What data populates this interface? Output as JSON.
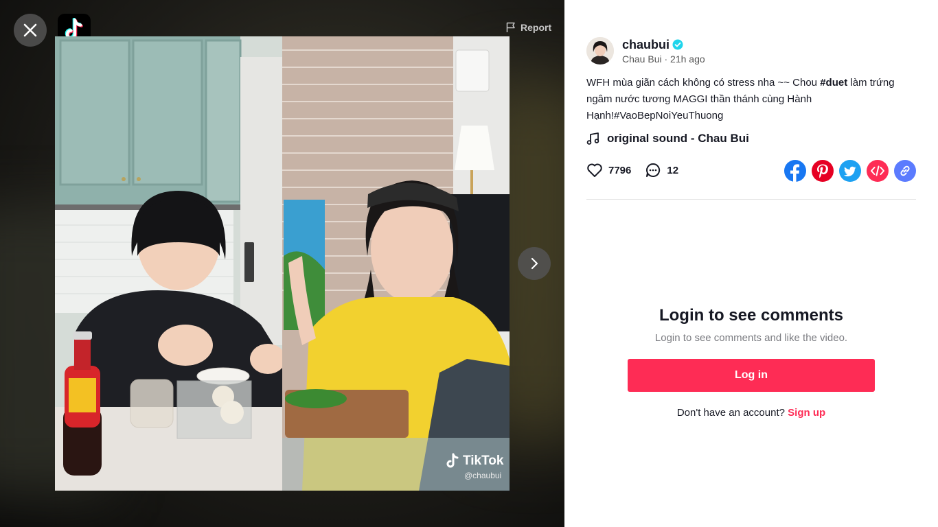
{
  "header": {
    "report_label": "Report"
  },
  "video": {
    "watermark_brand": "TikTok",
    "watermark_handle": "@chaubui"
  },
  "author": {
    "username": "chaubui",
    "display_name": "Chau Bui",
    "separator": " · ",
    "posted": "21h ago",
    "verified": true
  },
  "description": {
    "part1": "WFH mùa giãn cách không có stress nha ~~ Chou ",
    "hashtag1": "#duet",
    "part2": " làm trứng ngâm nước tương MAGGI thần thánh cùng Hành Hạnh!",
    "hashtag2": "#VaoBepNoiYeuThuong"
  },
  "sound": {
    "label": "original sound - Chau Bui",
    "icon": "music-note-icon"
  },
  "stats": {
    "likes": "7796",
    "comments": "12"
  },
  "share": [
    {
      "name": "facebook",
      "icon": "facebook-icon",
      "color": "#1877f2"
    },
    {
      "name": "pinterest",
      "icon": "pinterest-icon",
      "color": "#e60023"
    },
    {
      "name": "twitter",
      "icon": "twitter-icon",
      "color": "#1da1f2"
    },
    {
      "name": "embed",
      "icon": "embed-icon",
      "color": "#fe2c55"
    },
    {
      "name": "copy-link",
      "icon": "link-icon",
      "color": "#5b7bfe"
    }
  ],
  "login": {
    "title": "Login to see comments",
    "subtitle": "Login to see comments and like the video.",
    "button_label": "Log in",
    "prompt": "Don't have an account?",
    "signup_label": "Sign up"
  },
  "colors": {
    "accent": "#fe2c55",
    "text": "#161823",
    "verified": "#20d5ec"
  }
}
